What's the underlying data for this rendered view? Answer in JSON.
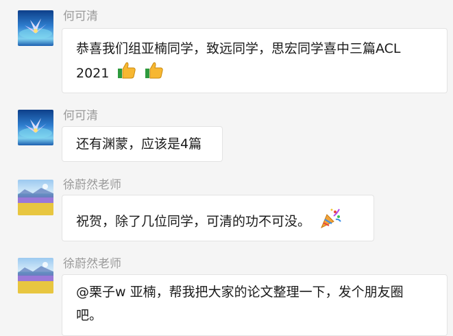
{
  "messages": [
    {
      "sender": "何可清",
      "avatar": "lily-flower-avatar",
      "line1": "恭喜我们组亚楠同学，致远同学，思宏同学喜中三篇ACL",
      "line2": "2021",
      "emojis": [
        "thumbs-up-icon",
        "thumbs-up-icon"
      ]
    },
    {
      "sender": "何可清",
      "avatar": "lily-flower-avatar",
      "line1": "还有渊蒙，应该是4篇"
    },
    {
      "sender": "徐蔚然老师",
      "avatar": "flower-field-avatar",
      "line1": "祝贺，除了几位同学，可清的功不可没。",
      "emojis": [
        "party-popper-icon"
      ]
    },
    {
      "sender": "徐蔚然老师",
      "avatar": "flower-field-avatar",
      "line1": "@栗子w 亚楠，帮我把大家的论文整理一下，发个朋友圈",
      "line2": "吧。"
    }
  ],
  "colors": {
    "background": "#f5f5f5",
    "bubble": "#ffffff",
    "sender_name": "#9a9a9a",
    "text": "#1a1a1a"
  }
}
